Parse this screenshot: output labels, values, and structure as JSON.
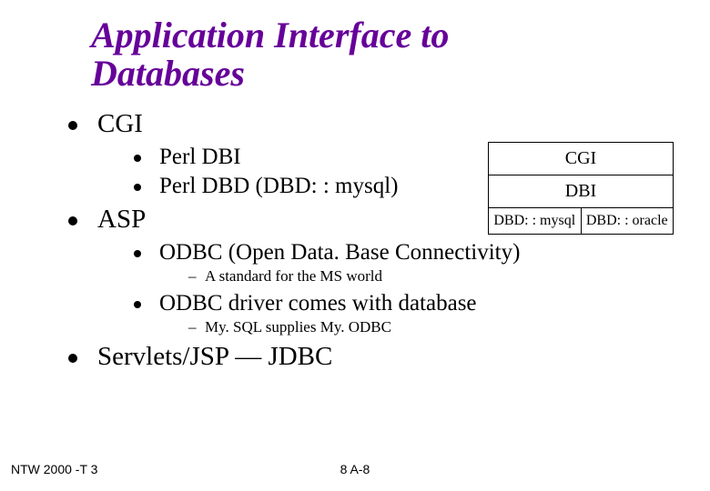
{
  "title_line1": "Application Interface to",
  "title_line2": "Databases",
  "bullets": {
    "b1": "CGI",
    "b1_1": "Perl DBI",
    "b1_2": "Perl DBD (DBD: : mysql)",
    "b2": "ASP",
    "b2_1": "ODBC (Open Data. Base Connectivity)",
    "b2_1_1": "A standard for the MS world",
    "b2_2": "ODBC driver comes with database",
    "b2_2_1": "My. SQL supplies My. ODBC",
    "b3": "Servlets/JSP — JDBC"
  },
  "diagram": {
    "top": "CGI",
    "mid": "DBI",
    "bl": "DBD: : mysql",
    "br": "DBD: : oracle"
  },
  "footer": {
    "left": "NTW 2000 -T 3",
    "center": "8 A-8"
  }
}
